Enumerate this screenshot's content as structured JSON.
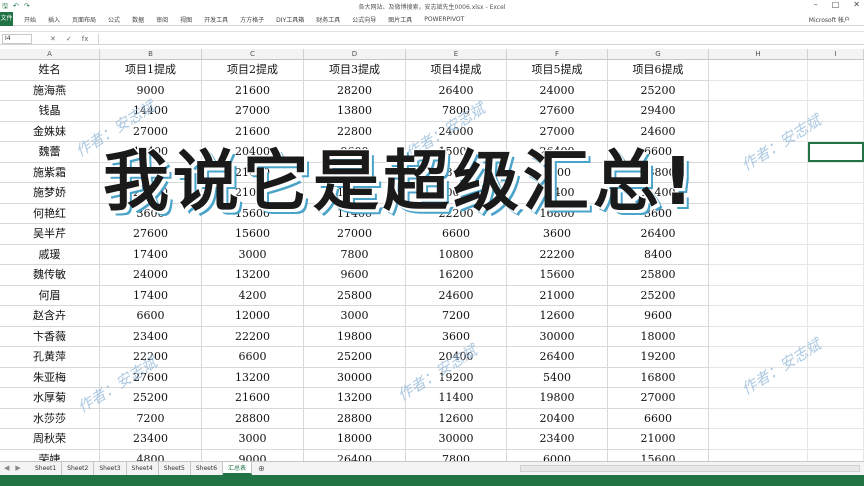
{
  "window": {
    "title": "各大网站、及微博搜索，安志斌先生0006.xlsx - Excel",
    "account": "Microsoft 帐户"
  },
  "quick_access": {
    "save": "🖫",
    "undo": "↶",
    "redo": "↷"
  },
  "ribbon": {
    "file_tab": "文件",
    "tabs": [
      "开始",
      "插入",
      "页面布局",
      "公式",
      "数据",
      "审阅",
      "视图",
      "开发工具",
      "方方格子",
      "DIY工具箱",
      "财务工具",
      "公式向导",
      "图片工具",
      "POWERPIVOT"
    ]
  },
  "formula_bar": {
    "name_box": "I4",
    "cancel": "✕",
    "confirm": "✓",
    "fx": "fx",
    "value": ""
  },
  "columns": [
    "A",
    "B",
    "C",
    "D",
    "E",
    "F",
    "G",
    "H",
    "I"
  ],
  "table": {
    "header": [
      "姓名",
      "项目1提成",
      "项目2提成",
      "项目3提成",
      "项目4提成",
      "项目5提成",
      "项目6提成"
    ],
    "rows": [
      [
        "施海燕",
        "9000",
        "21600",
        "28200",
        "26400",
        "24000",
        "25200"
      ],
      [
        "钱晶",
        "14400",
        "27000",
        "13800",
        "7800",
        "27600",
        "29400"
      ],
      [
        "金姝妹",
        "27000",
        "21600",
        "22800",
        "24000",
        "27000",
        "24600"
      ],
      [
        "魏蕾",
        "17400",
        "20400",
        "9600",
        "15000",
        "26400",
        "6600"
      ],
      [
        "施紫霜",
        "23400",
        "21600",
        "18000",
        "18600",
        "7800",
        "13800"
      ],
      [
        "施梦娇",
        "25200",
        "21000",
        "16200",
        "30000",
        "14400",
        "11400"
      ],
      [
        "何艳红",
        "3600",
        "15600",
        "11400",
        "22200",
        "16800",
        "3600"
      ],
      [
        "吴半芹",
        "27600",
        "15600",
        "27000",
        "6600",
        "3600",
        "26400"
      ],
      [
        "戚瑗",
        "17400",
        "3000",
        "7800",
        "10800",
        "22200",
        "8400"
      ],
      [
        "魏传敏",
        "24000",
        "13200",
        "9600",
        "16200",
        "15600",
        "25800"
      ],
      [
        "何眉",
        "17400",
        "4200",
        "25800",
        "24600",
        "21000",
        "25200"
      ],
      [
        "赵含卉",
        "6600",
        "12000",
        "3000",
        "7200",
        "12600",
        "9600"
      ],
      [
        "卞香薇",
        "23400",
        "22200",
        "19800",
        "3600",
        "30000",
        "18000"
      ],
      [
        "孔黄萍",
        "22200",
        "6600",
        "25200",
        "20400",
        "26400",
        "19200"
      ],
      [
        "朱亚梅",
        "27600",
        "13200",
        "30000",
        "19200",
        "5400",
        "16800"
      ],
      [
        "水厚菊",
        "25200",
        "21600",
        "13200",
        "11400",
        "19800",
        "27000"
      ],
      [
        "水莎莎",
        "7200",
        "28800",
        "28800",
        "12600",
        "20400",
        "6600"
      ],
      [
        "周秋荣",
        "23400",
        "3000",
        "18000",
        "30000",
        "23400",
        "21000"
      ],
      [
        "荣婕",
        "4800",
        "9000",
        "26400",
        "7800",
        "6000",
        "15600"
      ]
    ]
  },
  "overlay": {
    "headline": "我说它是超级汇总!",
    "watermark": "作者：安志斌"
  },
  "sheet_tabs": {
    "nav_prev": "◀",
    "nav_next": "▶",
    "items": [
      "Sheet1",
      "Sheet2",
      "Sheet3",
      "Sheet4",
      "Sheet5",
      "Sheet6",
      "汇总表"
    ],
    "active": "汇总表",
    "add": "⊕"
  },
  "colors": {
    "accent": "#217346",
    "watermark": "#9fc0dd",
    "headline_shadow": "#4aa3c9"
  }
}
